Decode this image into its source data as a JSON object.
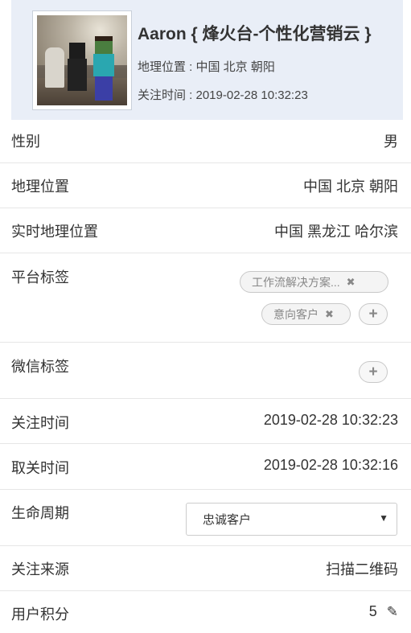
{
  "profile": {
    "name": "Aaron { 烽火台-个性化营销云 }",
    "location_line": "地理位置 : 中国 北京 朝阳",
    "follow_line": "关注时间 : 2019-02-28 10:32:23"
  },
  "fields": {
    "gender": {
      "label": "性别",
      "value": "男"
    },
    "geo": {
      "label": "地理位置",
      "value": "中国 北京 朝阳"
    },
    "realtime_geo": {
      "label": "实时地理位置",
      "value": "中国 黑龙江 哈尔滨"
    },
    "platform_tags": {
      "label": "平台标签",
      "tags": [
        "工作流解决方案...",
        "意向客户"
      ]
    },
    "wechat_tags": {
      "label": "微信标签"
    },
    "follow_time": {
      "label": "关注时间",
      "value": "2019-02-28 10:32:23"
    },
    "unfollow_time": {
      "label": "取关时间",
      "value": "2019-02-28 10:32:16"
    },
    "lifecycle": {
      "label": "生命周期",
      "selected": "忠诚客户"
    },
    "follow_source": {
      "label": "关注来源",
      "value": "扫描二维码"
    },
    "points": {
      "label": "用户积分",
      "value": "5"
    }
  },
  "glyphs": {
    "remove": "✖",
    "add": "+",
    "dropdown": "▼",
    "edit": "✎"
  }
}
